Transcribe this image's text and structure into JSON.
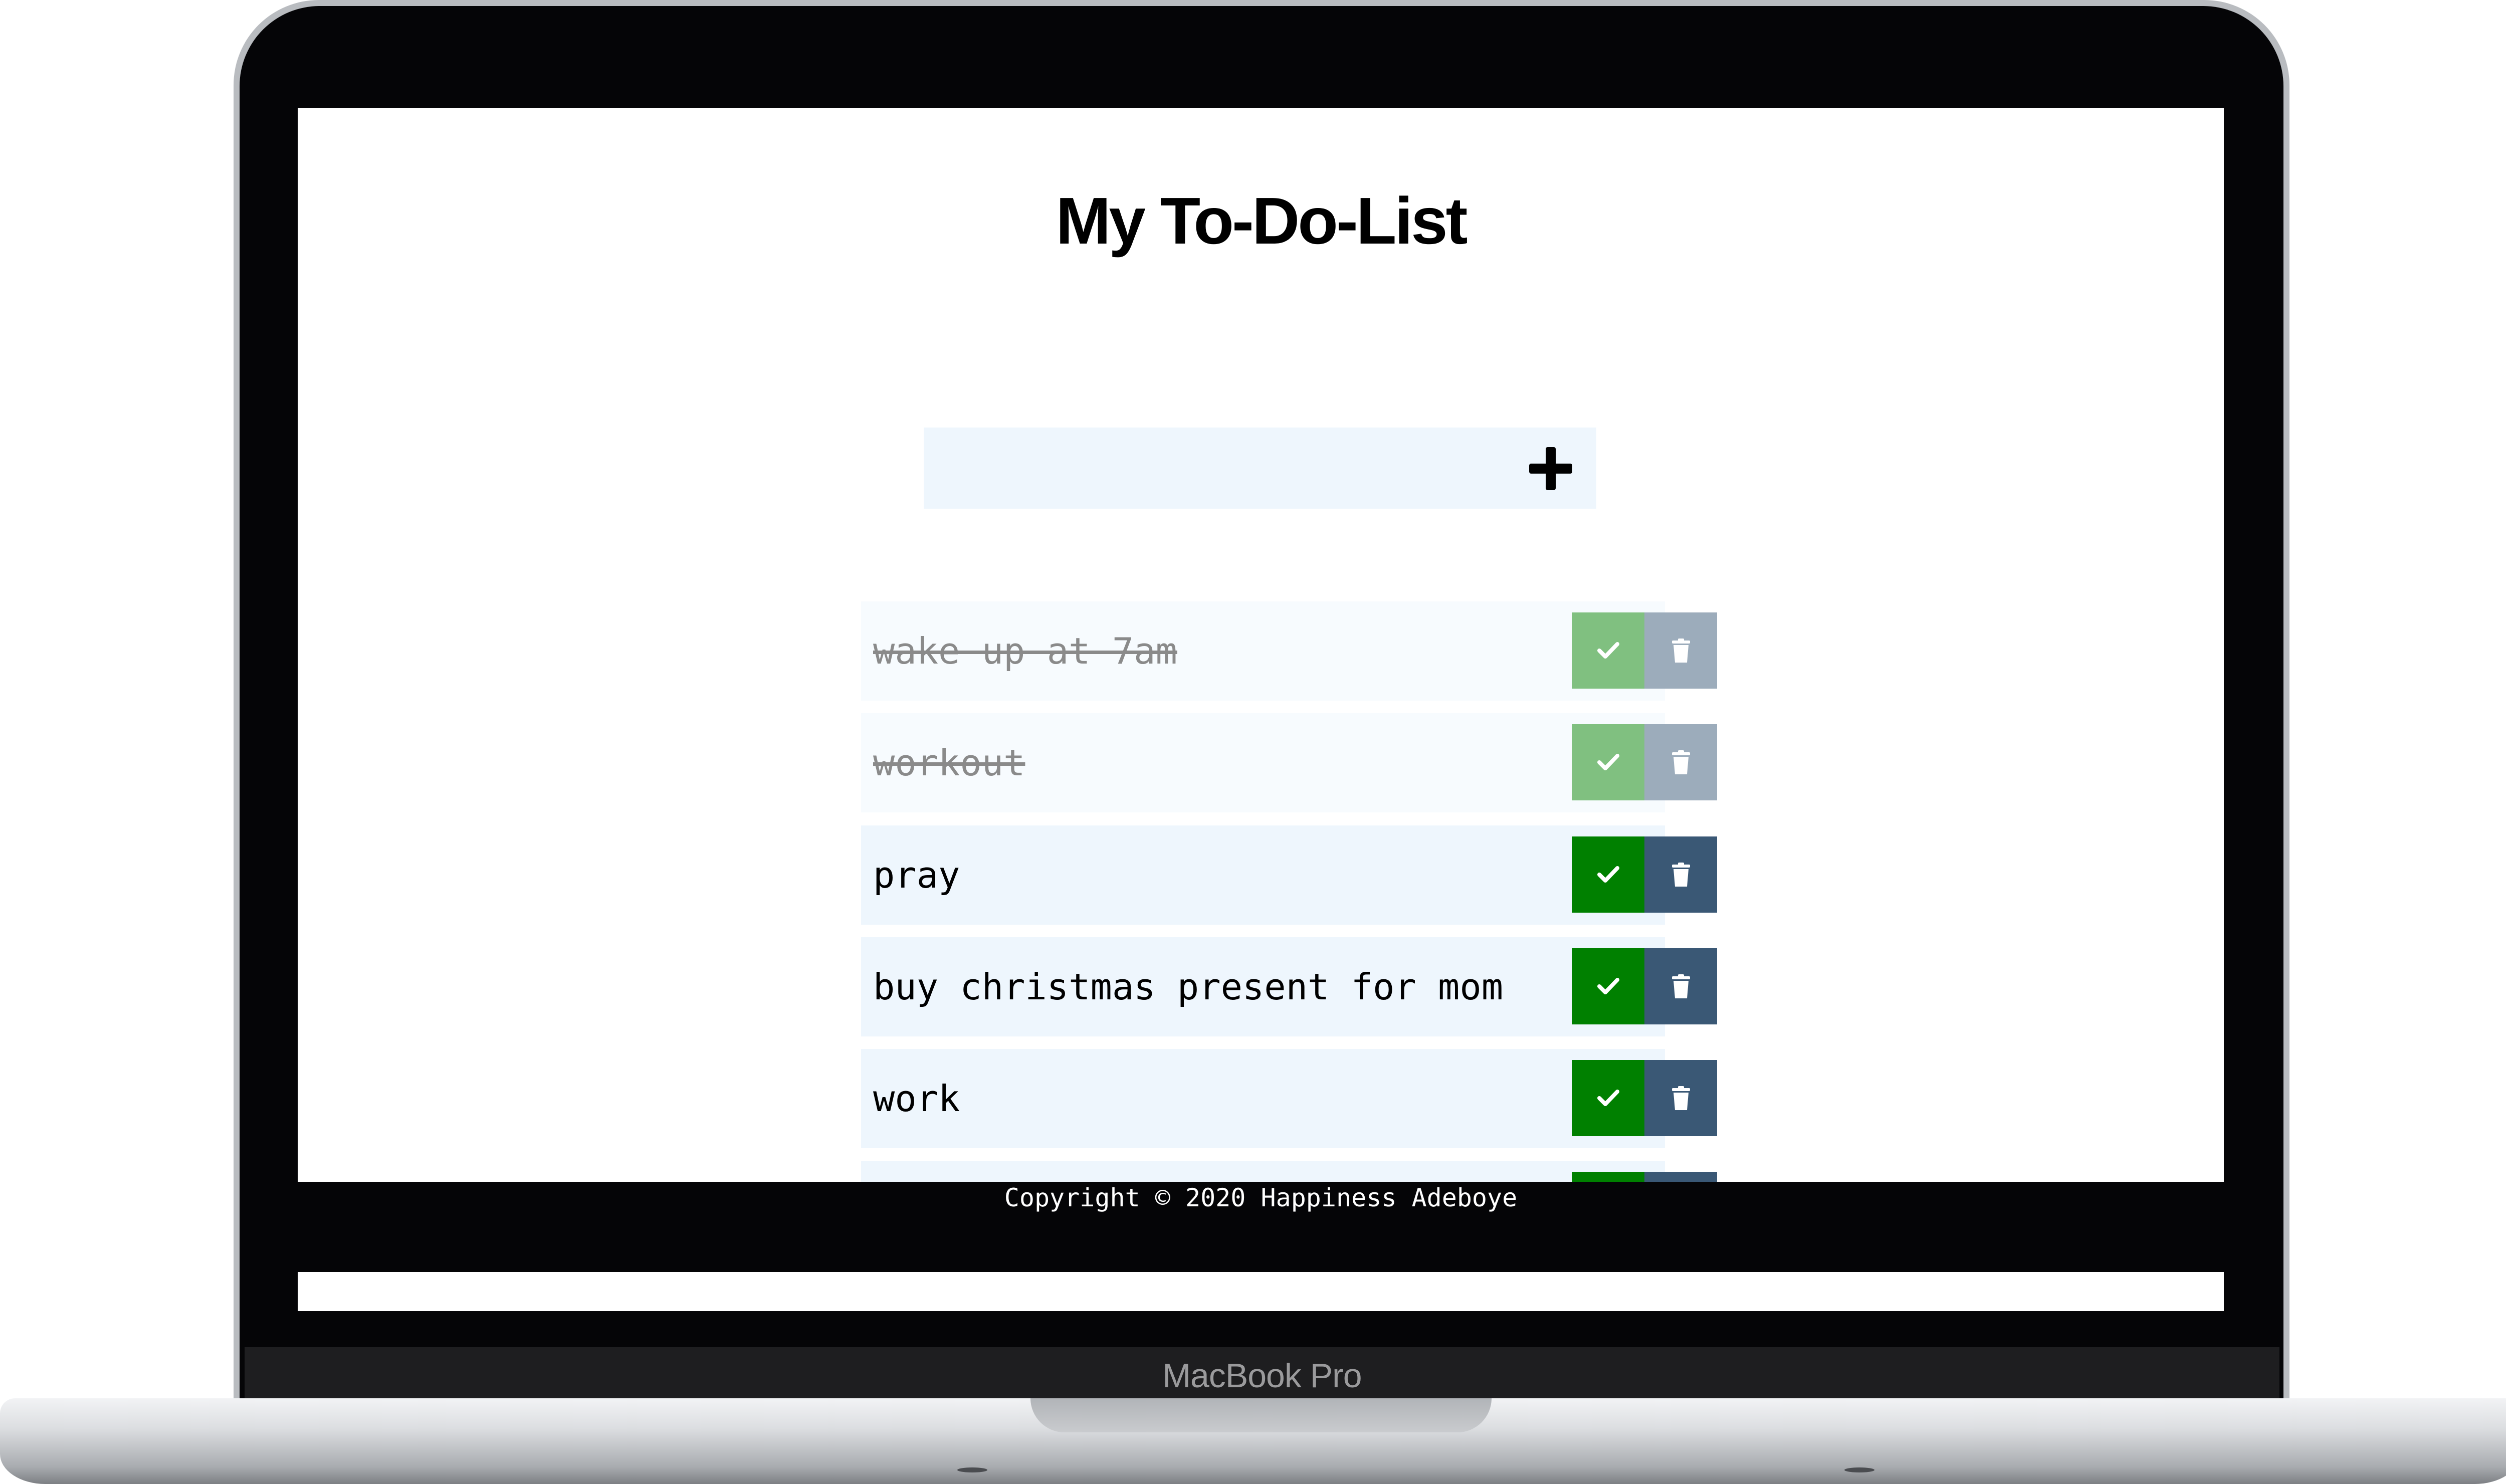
{
  "page": {
    "title": "My To-Do-List"
  },
  "add_form": {
    "input_value": "",
    "input_placeholder": "",
    "add_icon": "plus-icon"
  },
  "todos": [
    {
      "text": "wake up at 7am",
      "completed": true
    },
    {
      "text": "workout",
      "completed": true
    },
    {
      "text": "pray",
      "completed": false
    },
    {
      "text": "buy christmas present for mom",
      "completed": false
    },
    {
      "text": "work",
      "completed": false
    },
    {
      "text": "",
      "completed": false
    }
  ],
  "icons": {
    "complete": "check-icon",
    "delete": "trash-icon"
  },
  "colors": {
    "complete_button": "#008000",
    "trash_button": "#3a5875",
    "item_background": "#eef6fd"
  },
  "footer": {
    "copyright": "Copyright © 2020 Happiness Adeboye"
  },
  "device": {
    "label": "MacBook Pro"
  }
}
